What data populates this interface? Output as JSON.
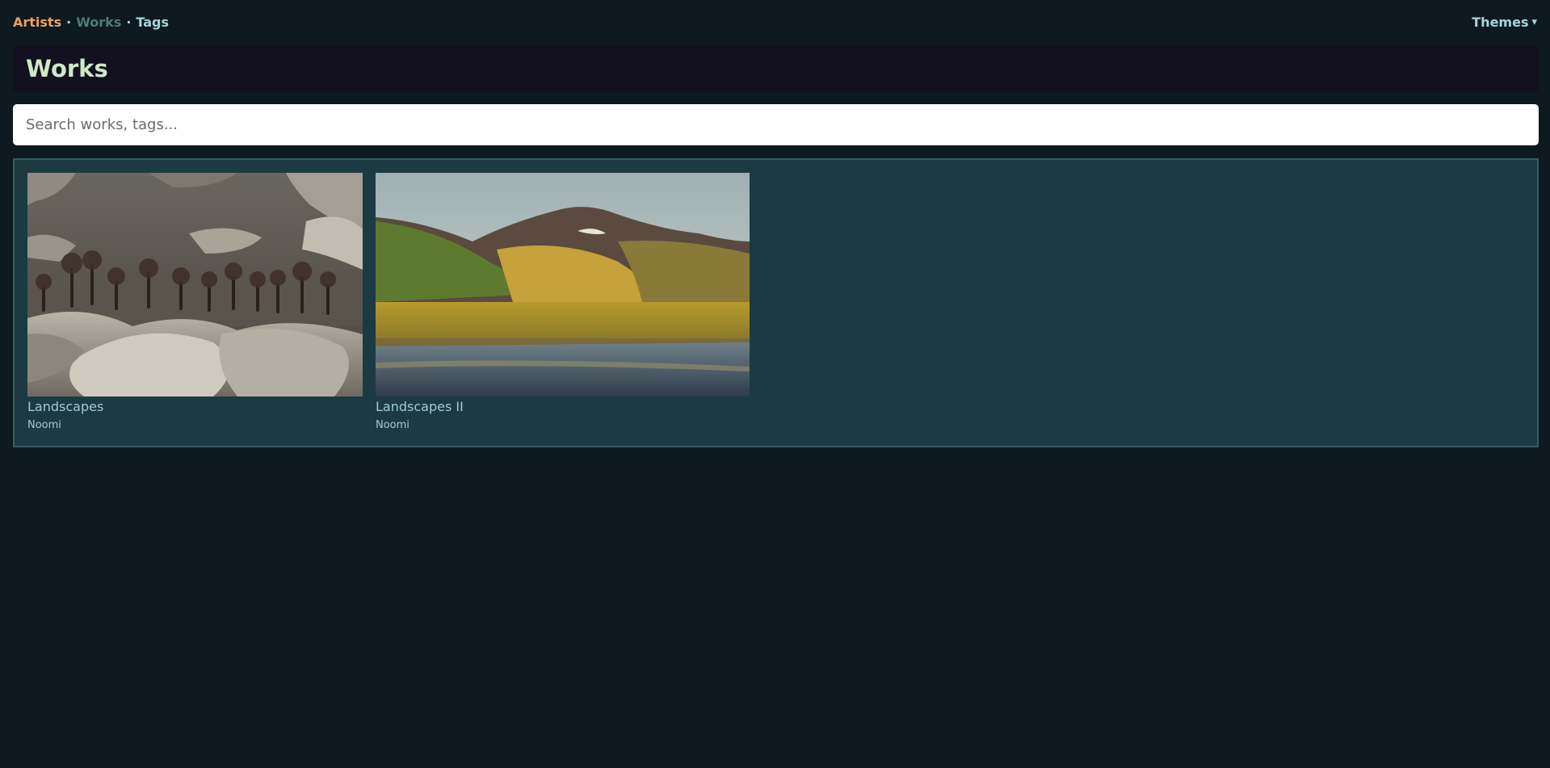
{
  "nav": {
    "links": [
      {
        "label": "Artists",
        "color": "#e9a25f"
      },
      {
        "label": "Works",
        "color": "#4f7a78"
      },
      {
        "label": "Tags",
        "color": "#a8d4dc"
      }
    ],
    "separator": "·",
    "themes_label": "Themes",
    "themes_icon": "caret-down-icon",
    "themes_caret": "▾"
  },
  "page": {
    "title": "Works"
  },
  "search": {
    "placeholder": "Search works, tags...",
    "value": ""
  },
  "works": [
    {
      "title": "Landscapes",
      "artist": "Noomi",
      "image": "rocky desert landscape with bare trees"
    },
    {
      "title": "Landscapes II",
      "artist": "Noomi",
      "image": "green mountains over golden plain and river"
    }
  ]
}
